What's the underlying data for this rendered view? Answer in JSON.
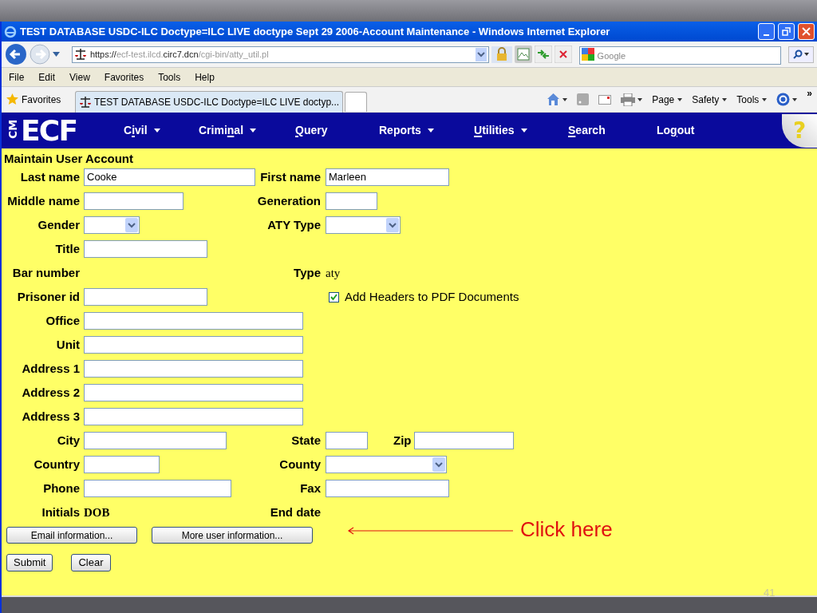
{
  "window": {
    "title": "TEST DATABASE USDC-ILC Doctype=ILC LIVE doctype Sept 29 2006-Account Maintenance - Windows Internet Explorer"
  },
  "address_bar": {
    "url_parts": [
      {
        "text": "https://",
        "emphasis": true
      },
      {
        "text": "ecf-test.ilcd.",
        "emphasis": false
      },
      {
        "text": "circ7.dcn",
        "emphasis": true
      },
      {
        "text": "/cgi-bin/atty_util.pl",
        "emphasis": false
      }
    ]
  },
  "search_box": {
    "placeholder": "Google"
  },
  "menu_bar": [
    "File",
    "Edit",
    "View",
    "Favorites",
    "Tools",
    "Help"
  ],
  "favorites_bar": {
    "favorites": "Favorites",
    "tabs": [
      {
        "label": "TEST DATABASE USDC-ILC Doctype=ILC LIVE doctyp...",
        "selected": true
      }
    ],
    "commands": [
      {
        "label": "Page"
      },
      {
        "label": "Safety"
      },
      {
        "label": "Tools"
      }
    ],
    "overflow": "»"
  },
  "nav": {
    "logo_small": "CM",
    "logo": "ECF",
    "help": "?",
    "items": [
      {
        "label_parts": [
          {
            "text": "C",
            "underline": false
          },
          {
            "text": "i",
            "underline": true
          },
          {
            "text": "vil",
            "underline": false
          }
        ],
        "dropdown": true
      },
      {
        "label_parts": [
          {
            "text": "Crimi",
            "underline": false
          },
          {
            "text": "n",
            "underline": true
          },
          {
            "text": "al",
            "underline": false
          }
        ],
        "dropdown": true
      },
      {
        "label_parts": [
          {
            "text": "Q",
            "underline": true
          },
          {
            "text": "uery",
            "underline": false
          }
        ],
        "dropdown": false
      },
      {
        "label_parts": [
          {
            "text": "Reports",
            "underline": false
          }
        ],
        "dropdown": true
      },
      {
        "label_parts": [
          {
            "text": "U",
            "underline": true
          },
          {
            "text": "tilities",
            "underline": false
          }
        ],
        "dropdown": true
      },
      {
        "label_parts": [
          {
            "text": "S",
            "underline": true
          },
          {
            "text": "earch",
            "underline": false
          }
        ],
        "dropdown": false
      },
      {
        "label_parts": [
          {
            "text": "Lo",
            "underline": false
          },
          {
            "text": "g",
            "underline": true
          },
          {
            "text": "out",
            "underline": false
          }
        ],
        "dropdown": false
      }
    ]
  },
  "form": {
    "title": "Maintain User Account",
    "rows": [
      [
        {
          "label": "Last name",
          "kind": "text",
          "value": "Cooke"
        },
        {
          "label": "First name",
          "kind": "text",
          "value": "Marleen"
        }
      ],
      [
        {
          "label": "Middle name",
          "kind": "text"
        },
        {
          "label": "Generation",
          "kind": "text"
        }
      ],
      [
        {
          "label": "Gender",
          "kind": "select"
        },
        {
          "label": "ATY Type",
          "kind": "select"
        }
      ],
      [
        {
          "label": "Title",
          "kind": "text"
        }
      ],
      [
        {
          "label": "Bar number",
          "kind": "none"
        },
        {
          "label": "Type",
          "kind": "static",
          "value": "aty"
        }
      ],
      [
        {
          "label": "Prisoner id",
          "kind": "text"
        },
        {
          "label": "Add Headers to PDF Documents",
          "kind": "checkbox",
          "checked": true
        }
      ],
      [
        {
          "label": "Office",
          "kind": "text"
        }
      ],
      [
        {
          "label": "Unit",
          "kind": "text"
        }
      ],
      [
        {
          "label": "Address 1",
          "kind": "text"
        }
      ],
      [
        {
          "label": "Address 2",
          "kind": "text"
        }
      ],
      [
        {
          "label": "Address 3",
          "kind": "text"
        }
      ],
      [
        {
          "label": "City",
          "kind": "text"
        },
        {
          "label": "State",
          "kind": "text"
        },
        {
          "label": "Zip",
          "kind": "text"
        }
      ],
      [
        {
          "label": "Country",
          "kind": "text"
        },
        {
          "label": "County",
          "kind": "select"
        }
      ],
      [
        {
          "label": "Phone",
          "kind": "text"
        },
        {
          "label": "Fax",
          "kind": "text"
        }
      ],
      [
        {
          "label": "Initials",
          "kind": "caption",
          "value": "DOB"
        },
        {
          "label": "End date",
          "kind": "none"
        }
      ]
    ],
    "info_buttons": [
      "Email information...",
      "More user information..."
    ],
    "action_buttons": [
      "Submit",
      "Clear"
    ]
  },
  "annotation": {
    "text": "Click here"
  },
  "slide_number": "41"
}
